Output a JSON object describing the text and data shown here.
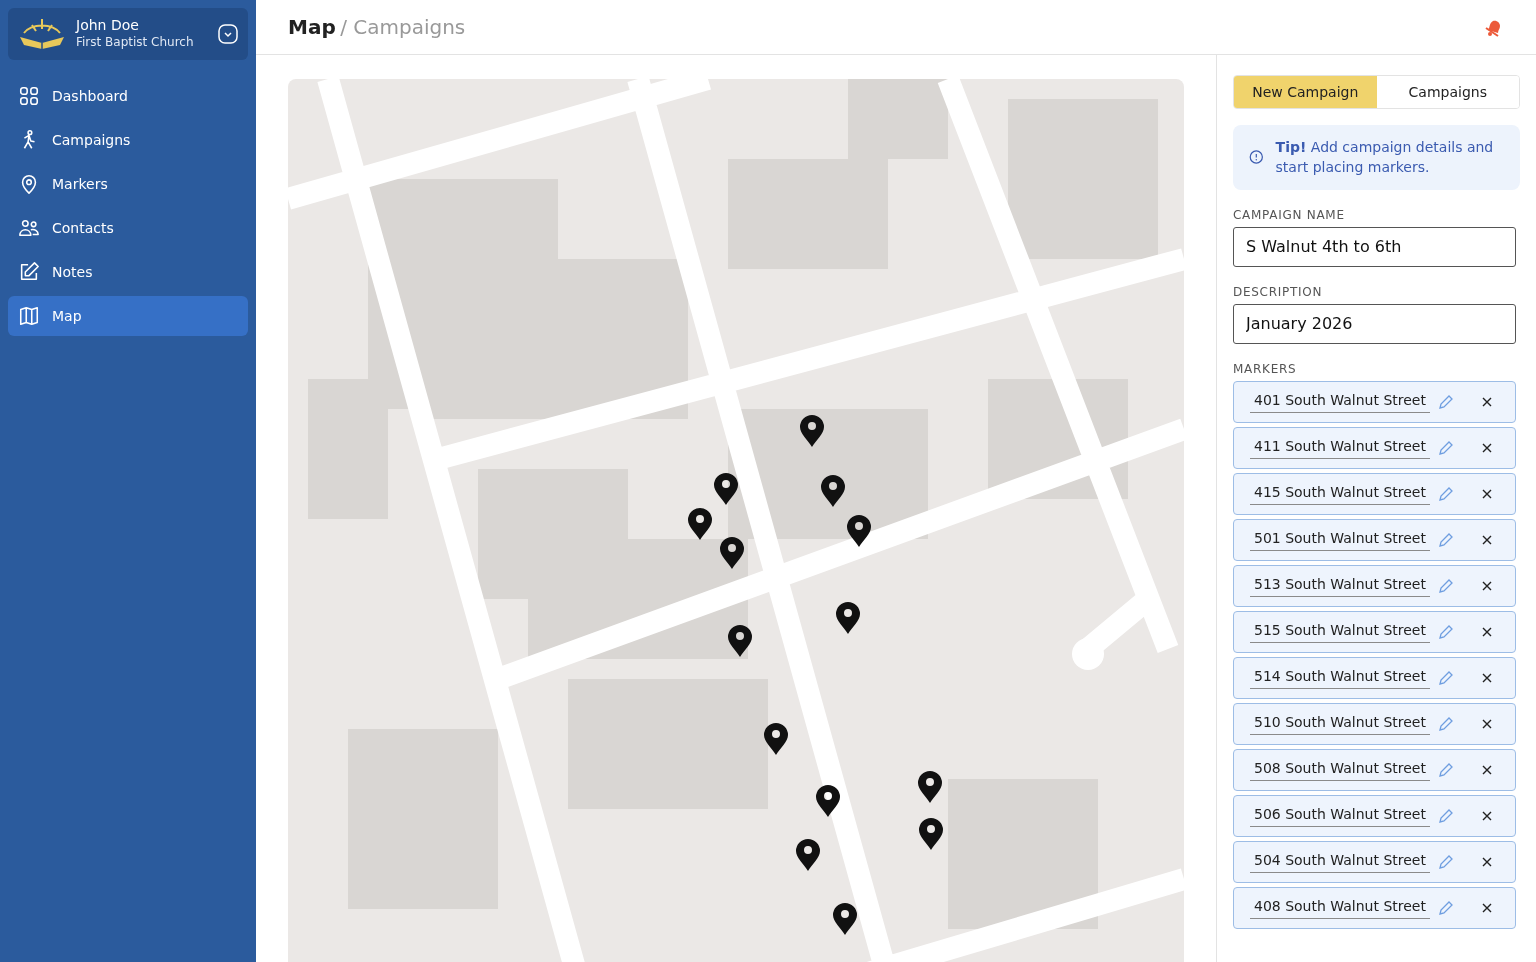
{
  "user": {
    "name": "John Doe",
    "organization": "First Baptist Church"
  },
  "nav": [
    {
      "label": "Dashboard",
      "selected": false
    },
    {
      "label": "Campaigns",
      "selected": false
    },
    {
      "label": "Markers",
      "selected": false
    },
    {
      "label": "Contacts",
      "selected": false
    },
    {
      "label": "Notes",
      "selected": false
    },
    {
      "label": "Map",
      "selected": true
    }
  ],
  "breadcrumb": {
    "current": "Map",
    "separator": "/",
    "section": "Campaigns"
  },
  "tabs": [
    {
      "label": "New Campaign",
      "selected": true
    },
    {
      "label": "Campaigns",
      "selected": false
    }
  ],
  "tip": "**Tip!** Add campaign details and start placing markers.",
  "fields": [
    {
      "label": "CAMPAIGN NAME",
      "value": "S Walnut 4th to 6th"
    },
    {
      "label": "DESCRIPTION",
      "value": "January 2026"
    }
  ],
  "markers_label": "MARKERS",
  "markers": [
    "401 South Walnut Street",
    "411 South Walnut Street",
    "415 South Walnut Street",
    "501 South Walnut Street",
    "513 South Walnut Street",
    "515 South Walnut Street",
    "514 South Walnut Street",
    "510 South Walnut Street",
    "508 South Walnut Street",
    "506 South Walnut Street",
    "504 South Walnut Street",
    "408 South Walnut Street"
  ]
}
